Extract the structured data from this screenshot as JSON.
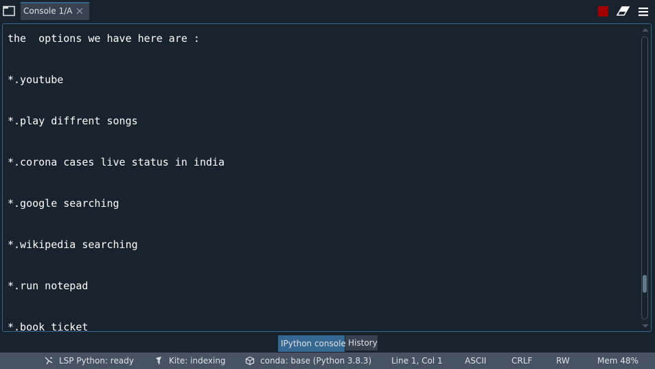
{
  "tabs": [
    {
      "label": "Console 1/A",
      "active": true
    }
  ],
  "console": {
    "lines": [
      "the  options we have here are :",
      "*.youtube",
      "*.play diffrent songs",
      "*.corona cases live status in india",
      "*.google searching",
      "*.wikipedia searching",
      "*.run notepad",
      "*.book ticket"
    ],
    "scroll_position_fraction": 0.9
  },
  "bottom_tabs": [
    {
      "label": "IPython console",
      "active": true
    },
    {
      "label": "History",
      "active": false
    }
  ],
  "status": {
    "lsp": "LSP Python: ready",
    "kite": "Kite: indexing",
    "conda": "conda: base (Python 3.8.3)",
    "cursor": "Line 1, Col 1",
    "encoding": "ASCII",
    "eol": "CRLF",
    "mode": "RW",
    "memory": "Mem 48%"
  },
  "icons": {
    "browse_tabs": "browse-tabs-icon",
    "tab_close": "close-icon",
    "stop": "stop-icon",
    "clear": "eraser-icon",
    "menu": "hamburger-menu-icon",
    "lsp": "lsp-icon",
    "kite": "kite-icon",
    "conda": "conda-cube-icon"
  },
  "colors": {
    "background": "#19232d",
    "accent": "#346792",
    "stop": "#a20000",
    "statusbar": "#455364"
  }
}
